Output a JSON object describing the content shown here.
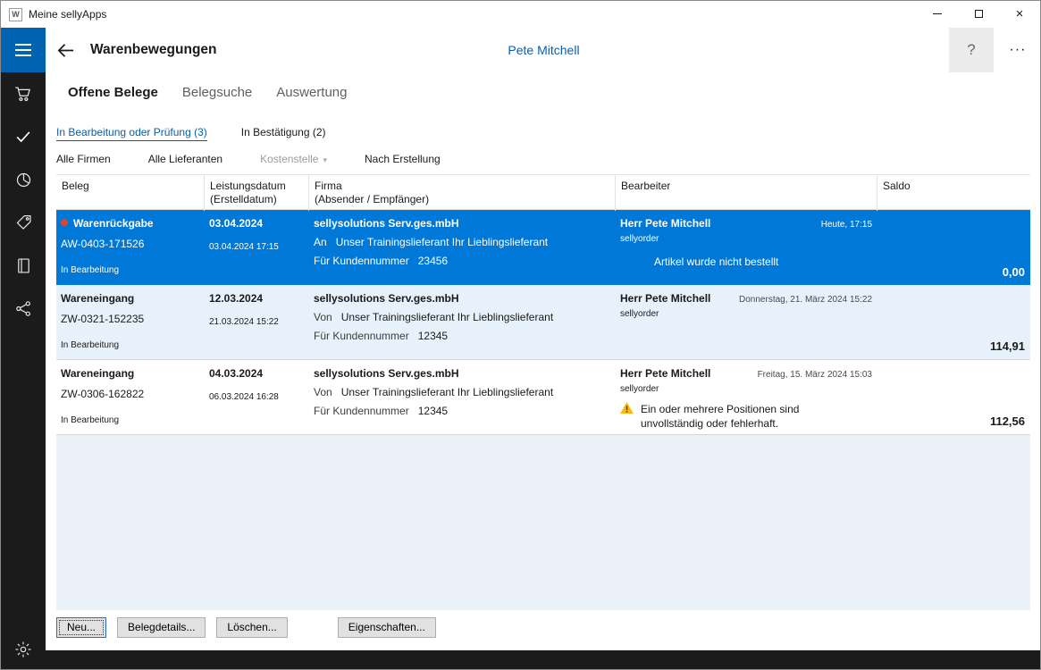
{
  "colors": {
    "accent": "#0078d7",
    "selected_row": "#0078d7",
    "sidebar_bg": "#1b1b1b",
    "hamburger_tile": "#0063b1",
    "link_blue": "#0a5dab",
    "warning_yellow": "#fdb913",
    "record_dot_red": "#e0452b"
  },
  "titlebar": {
    "app_title": "Meine sellyApps",
    "app_icon_letter": "W"
  },
  "header": {
    "title": "Warenbewegungen",
    "user_name": "Pete Mitchell",
    "help_label": "?",
    "more_label": "···"
  },
  "sidebar": {
    "items": [
      "menu",
      "cart",
      "tasks-check",
      "reports-pie",
      "offers-tag",
      "catalog-book",
      "share-network",
      "settings-gear"
    ]
  },
  "tabs": [
    {
      "label": "Offene Belege",
      "active": true
    },
    {
      "label": "Belegsuche",
      "active": false
    },
    {
      "label": "Auswertung",
      "active": false
    }
  ],
  "filters": {
    "status_links": [
      {
        "label": "In Bearbeitung oder Prüfung (3)",
        "active": true
      },
      {
        "label": "In Bestätigung (2)",
        "active": false
      }
    ],
    "dropdowns": [
      {
        "label": "Alle Firmen",
        "enabled": true
      },
      {
        "label": "Alle Lieferanten",
        "enabled": true
      },
      {
        "label": "Kostenstelle",
        "enabled": false,
        "caret": "▾"
      },
      {
        "label": "Nach Erstellung",
        "enabled": true
      }
    ]
  },
  "table": {
    "columns": [
      "Beleg",
      "Leistungsdatum\n(Erstelldatum)",
      "Firma\n(Absender / Empfänger)",
      "Bearbeiter",
      "Saldo"
    ],
    "rows": [
      {
        "selected": true,
        "type": "Warenrückgabe",
        "doc_no": "AW-0403-171526",
        "status": "In Bearbeitung",
        "date": "03.04.2024",
        "created": "03.04.2024 17:15",
        "company": "sellysolutions Serv.ges.mbH",
        "direction": "An",
        "partner": "Unser Trainingslieferant Ihr Lieblingslieferant",
        "customer_label": "Für Kundennummer",
        "customer_no": "23456",
        "editor": "Herr Pete Mitchell",
        "editor_app": "sellyorder",
        "timestamp": "Heute, 17:15",
        "note": "Artikel wurde nicht bestellt",
        "saldo": "0,00"
      },
      {
        "selected": false,
        "type": "Wareneingang",
        "doc_no": "ZW-0321-152235",
        "status": "In Bearbeitung",
        "date": "12.03.2024",
        "created": "21.03.2024 15:22",
        "company": "sellysolutions Serv.ges.mbH",
        "direction": "Von",
        "partner": "Unser Trainingslieferant Ihr Lieblingslieferant",
        "customer_label": "Für Kundennummer",
        "customer_no": "12345",
        "editor": "Herr Pete Mitchell",
        "editor_app": "sellyorder",
        "timestamp": "Donnerstag, 21. März 2024 15:22",
        "saldo": "114,91"
      },
      {
        "selected": false,
        "type": "Wareneingang",
        "doc_no": "ZW-0306-162822",
        "status": "In Bearbeitung",
        "date": "04.03.2024",
        "created": "06.03.2024 16:28",
        "company": "sellysolutions Serv.ges.mbH",
        "direction": "Von",
        "partner": "Unser Trainingslieferant Ihr Lieblingslieferant",
        "customer_label": "Für Kundennummer",
        "customer_no": "12345",
        "editor": "Herr Pete Mitchell",
        "editor_app": "sellyorder",
        "timestamp": "Freitag, 15. März 2024 15:03",
        "warning": "Ein oder mehrere Positionen sind unvollständig oder fehlerhaft.",
        "saldo": "112,56"
      }
    ]
  },
  "footer_buttons": [
    "Neu...",
    "Belegdetails...",
    "Löschen...",
    "Eigenschaften..."
  ]
}
